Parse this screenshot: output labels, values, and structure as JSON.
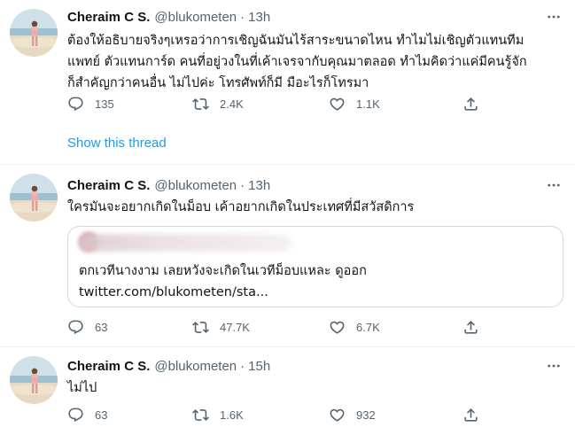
{
  "tweets": [
    {
      "display_name": "Cheraim C S.",
      "handle": "@blukometen",
      "separator": "·",
      "time": "13h",
      "text_lines": [
        "ต้องให้อธิบายจริงๆเหรอว่าการเชิญฉันมันไร้สาระขนาดไหน ทำไมไม่เชิญตัวแทนทีม",
        "แพทย์ ตัวแทนการ์ด คนที่อยู่วงในที่เค้าเจรจากับคุณมาตลอด ทำไมคิดว่าแค่มีคนรู้จัก",
        "ก็สำคัญกว่าคนอื่น ไม่ไปค่ะ โทรศัพท์ก็มี มือะไรก็โทรมา"
      ],
      "reply_count": "135",
      "retweet_count": "2.4K",
      "like_count": "1.1K",
      "show_thread": "Show this thread"
    },
    {
      "display_name": "Cheraim C S.",
      "handle": "@blukometen",
      "separator": "·",
      "time": "13h",
      "text": "ใครมันจะอยากเกิดในม็อบ เค้าอยากเกิดในประเทศที่มีสวัสดิการ",
      "quote": {
        "text_line1": "ตกเวทีนางงาม เลยหวังจะเกิดในเวทีม็อบแหละ ดูออก",
        "text_line2": "twitter.com/blukometen/sta..."
      },
      "reply_count": "63",
      "retweet_count": "47.7K",
      "like_count": "6.7K"
    },
    {
      "display_name": "Cheraim C S.",
      "handle": "@blukometen",
      "separator": "·",
      "time": "15h",
      "text": "ไม่ไป",
      "reply_count": "63",
      "retweet_count": "1.6K",
      "like_count": "932"
    }
  ],
  "icons": {
    "reply": "reply-icon",
    "retweet": "retweet-icon",
    "like": "heart-icon",
    "share": "share-icon",
    "more": "more-icon"
  },
  "colors": {
    "text": "#0f1419",
    "secondary": "#536471",
    "link": "#1d9bf0",
    "border": "#cfd9de"
  }
}
